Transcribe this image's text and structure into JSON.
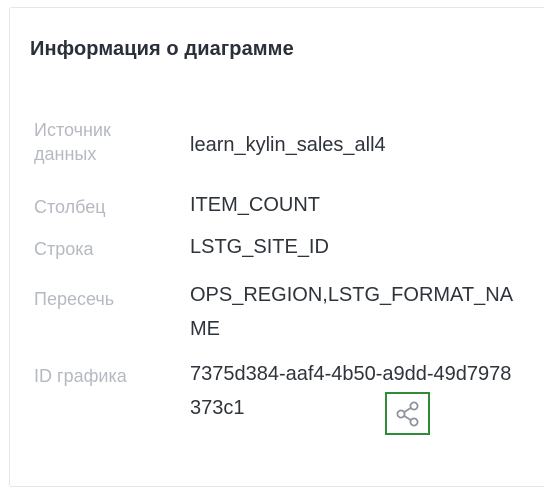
{
  "panel": {
    "title": "Информация о диаграмме",
    "rows": [
      {
        "label": "Источник данных",
        "value": "learn_kylin_sales_all4"
      },
      {
        "label": "Столбец",
        "value": "ITEM_COUNT"
      },
      {
        "label": "Строка",
        "value": "LSTG_SITE_ID"
      },
      {
        "label": "Пересечь",
        "value": "OPS_REGION,LSTG_FORMAT_NAME"
      },
      {
        "label": "ID графика",
        "value": "7375d384-aaf4-4b50-a9dd-49d7978373c1"
      }
    ],
    "share_icon": "share-icon",
    "colors": {
      "label": "#b5b9c1",
      "value": "#2e333c",
      "highlight": "#2e8b3a"
    }
  }
}
